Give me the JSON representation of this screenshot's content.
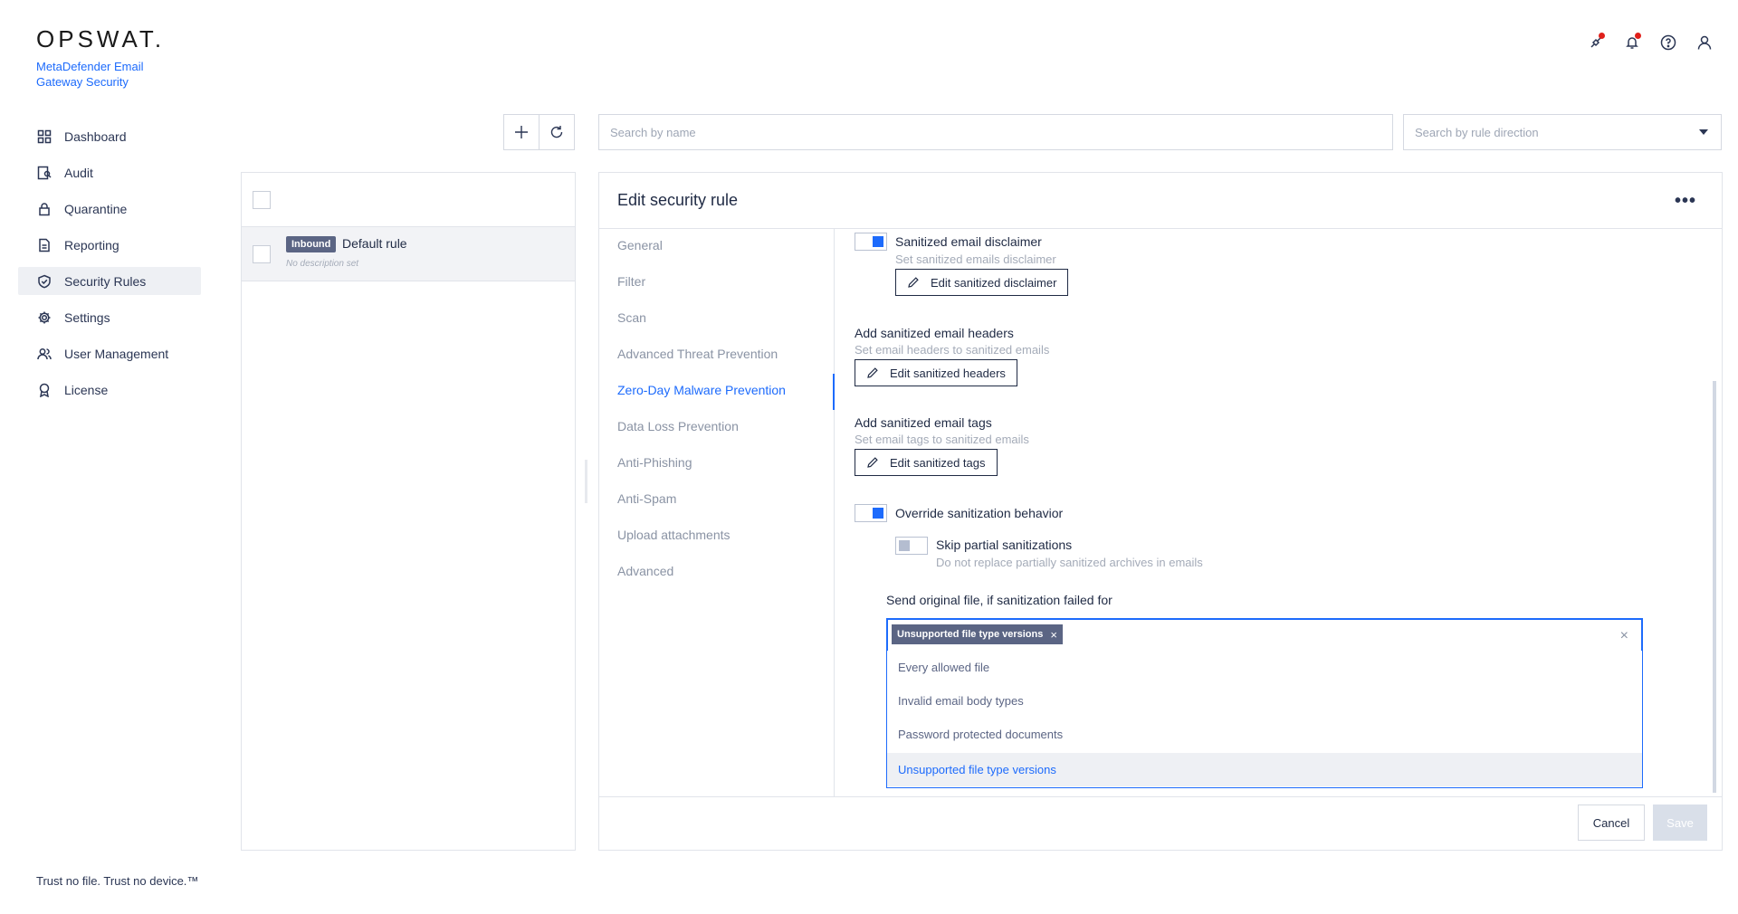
{
  "brand": {
    "logo": "OPSWAT.",
    "product": "MetaDefender Email Gateway Security"
  },
  "sidebar": {
    "items": [
      {
        "label": "Dashboard",
        "icon": "dashboard-icon"
      },
      {
        "label": "Audit",
        "icon": "audit-icon"
      },
      {
        "label": "Quarantine",
        "icon": "lock-icon"
      },
      {
        "label": "Reporting",
        "icon": "document-icon"
      },
      {
        "label": "Security Rules",
        "icon": "shield-check-icon",
        "active": true
      },
      {
        "label": "Settings",
        "icon": "gear-icon"
      },
      {
        "label": "User Management",
        "icon": "users-icon"
      },
      {
        "label": "License",
        "icon": "award-icon"
      }
    ]
  },
  "footer": {
    "tagline": "Trust no file. Trust no device.™"
  },
  "toolbar": {
    "search_name_placeholder": "Search by name",
    "search_direction_placeholder": "Search by rule direction"
  },
  "rules": [
    {
      "badge": "Inbound",
      "name": "Default rule",
      "description": "No description set"
    }
  ],
  "edit": {
    "title": "Edit security rule",
    "tabs": [
      "General",
      "Filter",
      "Scan",
      "Advanced Threat Prevention",
      "Zero-Day Malware Prevention",
      "Data Loss Prevention",
      "Anti-Phishing",
      "Anti-Spam",
      "Upload attachments",
      "Advanced"
    ],
    "active_tab": "Zero-Day Malware Prevention",
    "disclaimer": {
      "label": "Sanitized email disclaimer",
      "description": "Set sanitized emails disclaimer",
      "button": "Edit sanitized disclaimer",
      "enabled": true
    },
    "headers": {
      "label": "Add sanitized email headers",
      "description": "Set email headers to sanitized emails",
      "button": "Edit sanitized headers"
    },
    "tags": {
      "label": "Add sanitized email tags",
      "description": "Set email tags to sanitized emails",
      "button": "Edit sanitized tags"
    },
    "override": {
      "label": "Override sanitization behavior",
      "enabled": true
    },
    "skip_partial": {
      "label": "Skip partial sanitizations",
      "description": "Do not replace partially sanitized archives in emails",
      "enabled": false
    },
    "send_original": {
      "label": "Send original file, if sanitization failed for",
      "selected_chip": "Unsupported file type versions",
      "options": [
        "Every allowed file",
        "Invalid email body types",
        "Password protected documents",
        "Unsupported file type versions"
      ]
    },
    "cancel_label": "Cancel",
    "save_label": "Save"
  },
  "colors": {
    "accent": "#1d6bfc",
    "badge": "#5b6584",
    "alert_dot": "#e0201b"
  }
}
